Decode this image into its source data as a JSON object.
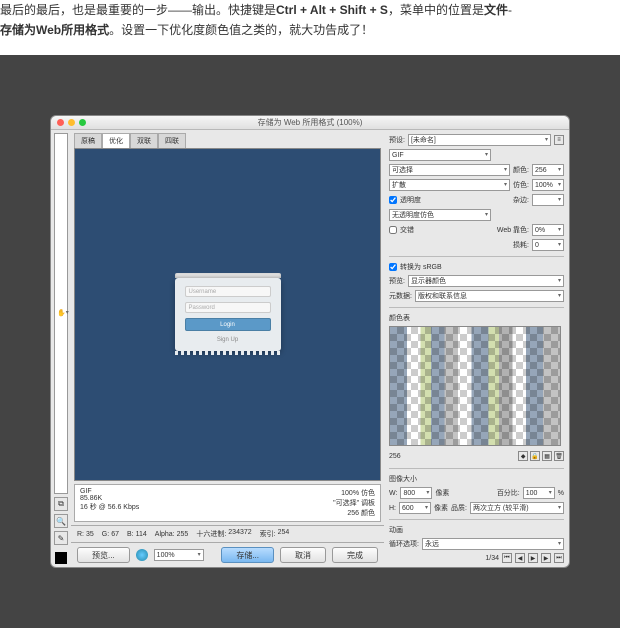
{
  "intro": {
    "p1_a": "最后的最后，也是最重要的一步——输出。快捷键是",
    "p1_b": "Ctrl + Alt + Shift + S",
    "p1_c": "，菜单中的位置是",
    "p1_d": "文件",
    "p1_e": "-",
    "p2_a": "存储为Web所用格式",
    "p2_b": "。设置一下优化度颜色值之类的，就大功告成了！"
  },
  "dialog": {
    "title": "存储为 Web 所用格式 (100%)"
  },
  "tabs": {
    "t0": "原稿",
    "t1": "优化",
    "t2": "双联",
    "t3": "四联"
  },
  "form": {
    "user": "Username",
    "pass": "Password",
    "login": "Login",
    "signup": "Sign Up"
  },
  "pstat": {
    "fmt": "GIF",
    "size": "85.86K",
    "speed": "16 秒 @ 56.6 Kbps",
    "q": "100% 仿色",
    "pal": "\"可选择\" 调板",
    "colors": "256 颜色"
  },
  "right": {
    "preset_lbl": "预设:",
    "preset": "[未命名]",
    "format": "GIF",
    "reduction": "可选择",
    "colors_lbl": "颜色:",
    "colors": "256",
    "dither": "扩散",
    "dither_amt_lbl": "仿色:",
    "dither_amt": "100%",
    "transparency": "透明度",
    "matte_lbl": "杂边:",
    "transdither": "无透明度仿色",
    "interlaced": "交错",
    "websnap_lbl": "Web 靠色:",
    "websnap": "0%",
    "loss_lbl": "损耗:",
    "loss": "0",
    "convert": "转换为 sRGB",
    "previewas_lbl": "预览:",
    "previewas": "显示器颜色",
    "metadata_lbl": "元数据:",
    "metadata": "版权和联系信息",
    "ct_title": "颜色表",
    "ct_count": "256",
    "size_title": "图像大小",
    "w_lbl": "W:",
    "w": "800",
    "h_lbl": "H:",
    "h": "600",
    "px": "像素",
    "pct_lbl": "百分比:",
    "pct": "100",
    "quality_lbl": "品质:",
    "quality": "两次立方 (较平滑)",
    "anim_title": "动画",
    "loop_lbl": "循环选项:",
    "loop": "永远"
  },
  "bottombar": {
    "preview_btn": "预览...",
    "save": "存储...",
    "cancel": "取消",
    "done": "完成"
  },
  "status": {
    "r": "R:",
    "rv": "35",
    "g": "G:",
    "gv": "67",
    "b": "B:",
    "bv": "114",
    "alpha": "Alpha:",
    "av": "255",
    "hex": "十六进制:",
    "hv": "234372",
    "idx": "索引:",
    "iv": "254",
    "zoom": "100%",
    "frame": "1/34"
  }
}
